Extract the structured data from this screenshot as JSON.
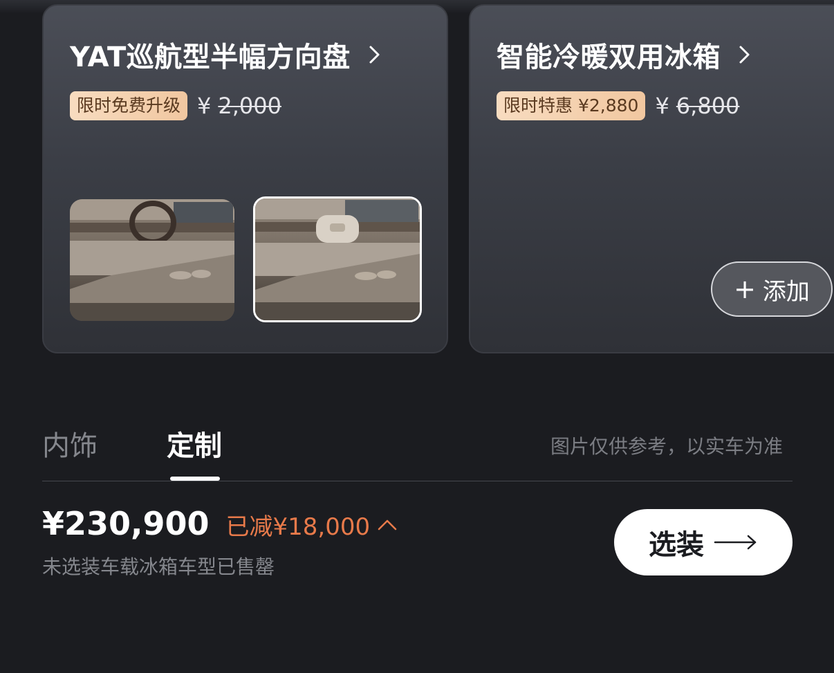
{
  "cards": [
    {
      "title": "YAT巡航型半幅方向盘",
      "badge": "限时免费升级",
      "currency": "¥",
      "original_price": "2,000"
    },
    {
      "title": "智能冷暖双用冰箱",
      "badge": "限时特惠 ¥2,880",
      "currency": "¥",
      "original_price": "6,800",
      "add_label": "添加"
    }
  ],
  "tabs": [
    {
      "label": "内饰",
      "active": false
    },
    {
      "label": "定制",
      "active": true
    }
  ],
  "tab_note": "图片仅供参考，以实车为准",
  "summary": {
    "total_price": "¥230,900",
    "discount": "已减¥18,000",
    "note": "未选装车载冰箱车型已售罄",
    "select_label": "选装"
  },
  "colors": {
    "background": "#1b1c20",
    "card": "#44474f",
    "badge": "#f3cda9",
    "discount": "#e87a4a",
    "button": "#ffffff"
  },
  "icons": {
    "card_chevron": "chevron-right-icon",
    "add": "plus-icon",
    "discount_toggle": "chevron-up-icon",
    "select_arrow": "arrow-right-icon"
  }
}
